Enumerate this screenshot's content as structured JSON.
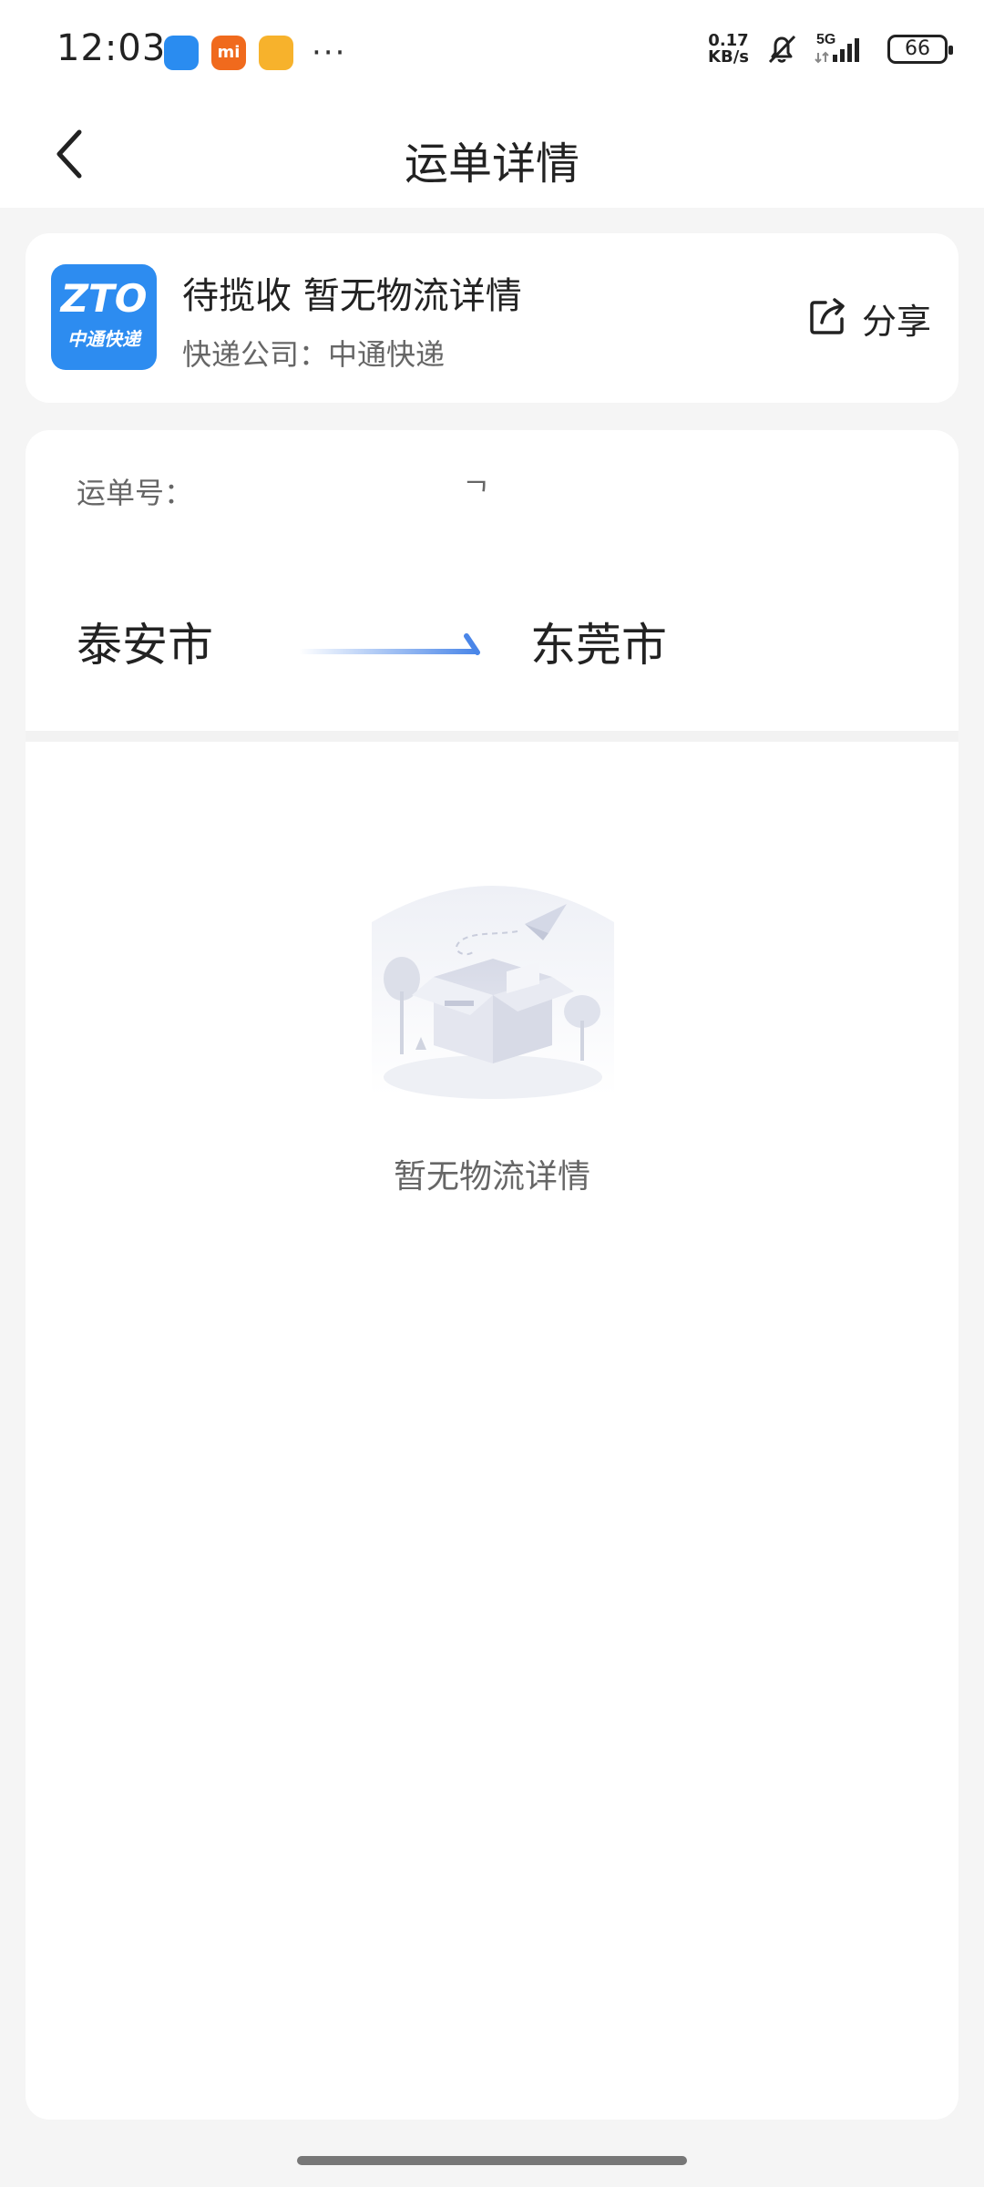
{
  "status_bar": {
    "time": "12:03",
    "net_speed_value": "0.17",
    "net_speed_unit": "KB/s",
    "network": "5G",
    "battery": "66"
  },
  "header": {
    "title": "运单详情"
  },
  "summary": {
    "logo_text": "ZTO",
    "logo_subtext": "中通快递",
    "status": "待揽收 暂无物流详情",
    "company_line": "快递公司：中通快递",
    "share_label": "分享"
  },
  "route": {
    "waybill_label": "运单号：",
    "waybill_tail": "ᄀ",
    "from_city": "泰安市",
    "to_city": "东莞市"
  },
  "empty": {
    "text": "暂无物流详情"
  },
  "colors": {
    "accent": "#2d8cf0",
    "background": "#f5f5f5"
  }
}
